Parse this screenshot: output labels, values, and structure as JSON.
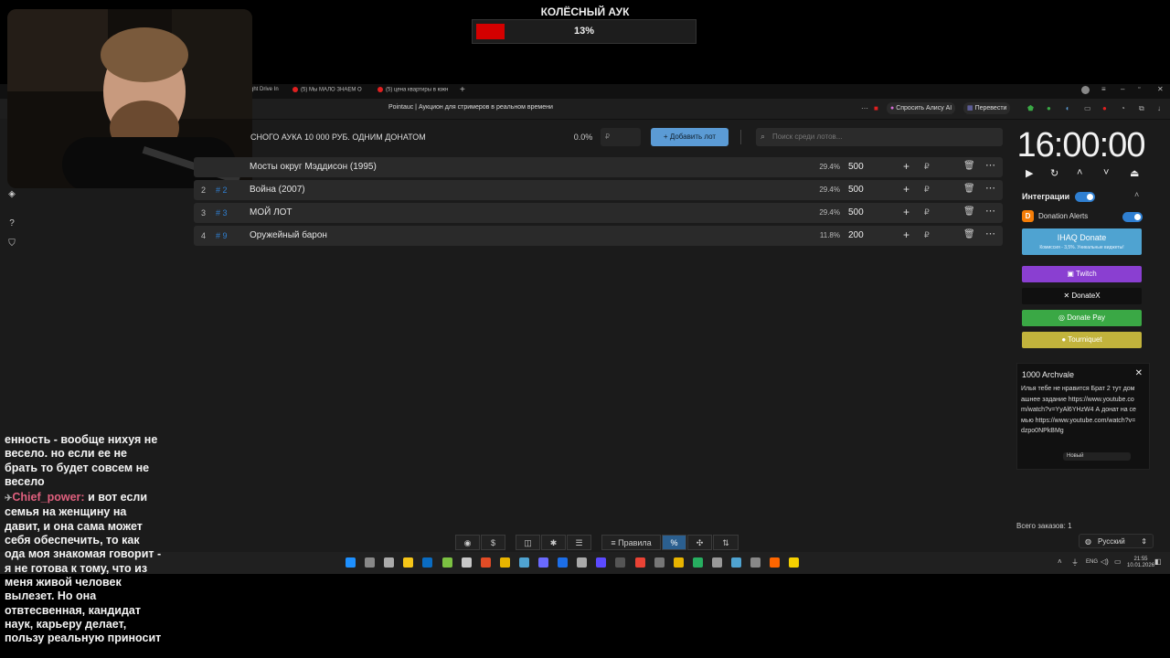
{
  "overlay": {
    "title": "КОЛЁСНЫЙ АУК",
    "progress_text": "13%",
    "progress": 0.13
  },
  "browser": {
    "tabs": [
      "ght Drive In",
      "(5) Мы МАЛО ЗНАЕМ О",
      "(5) цена квартиры в южн"
    ],
    "page_title": "Pointauc | Аукцион для стримеров в реальном времени",
    "ask_alice": "Спросить Алису AI",
    "translate": "Перевести"
  },
  "auction": {
    "title": "СНОГО АУКА 10 000 РУБ. ОДНИМ ДОНАТОМ",
    "pct": "0.0%",
    "rub_placeholder": "₽",
    "add_lot": "Добавить лот",
    "search_placeholder": "Поиск среди лотов...",
    "lots": [
      {
        "num": "",
        "id": "",
        "name": "Мосты округ Мэддисон (1995)",
        "pct": "29.4%",
        "amount": "500"
      },
      {
        "num": "2",
        "id": "# 2",
        "name": "Война (2007)",
        "pct": "29.4%",
        "amount": "500"
      },
      {
        "num": "3",
        "id": "# 3",
        "name": "МОЙ ЛОТ",
        "pct": "29.4%",
        "amount": "500"
      },
      {
        "num": "4",
        "id": "# 9",
        "name": "Оружейный барон",
        "pct": "11.8%",
        "amount": "200"
      }
    ]
  },
  "panel": {
    "timer": "16:00:00",
    "integrations": "Интеграции",
    "donation_alerts": "Donation Alerts",
    "ihaq_title": "IHAQ Donate",
    "ihaq_sub": "Комиссия - 3,5%. Уникальные виджеты!",
    "buttons": [
      {
        "label": "Twitch",
        "icon": "twitch-icon",
        "bg": "#8a3fd1",
        "fg": "#ffffff"
      },
      {
        "label": "DonateX",
        "icon": "x-icon",
        "bg": "#101010",
        "fg": "#ffffff"
      },
      {
        "label": "Donate Pay",
        "icon": "donatepay-icon",
        "bg": "#3aa845",
        "fg": "#ffffff"
      },
      {
        "label": "Tourniquet",
        "icon": "tourniquet-icon",
        "bg": "#c2b33c",
        "fg": "#ffffff"
      }
    ],
    "popup_title": "1000 Archvale",
    "popup_message": "Илья тебе не нравится Брат 2 тут домашнее задание https://www.youtube.com/watch?v=YyAl6YHzW4 А донат на семью https://www.youtube.com/watch?v=dzpo0NPkBMg",
    "popup_badge": "Новый",
    "orders_label": "Всего заказов:",
    "orders_count": "1",
    "language": "Русский"
  },
  "bottom_toolbar": {
    "rules": "Правила",
    "percent": "%"
  },
  "taskbar": {
    "lang": "ENG",
    "time": "21:55",
    "date": "10.01.2026"
  },
  "stream_chat": {
    "line1": "енность - вообще нихуя не весело. но если ее не брать то будет совсем не весело",
    "user": "Chief_power:",
    "message": "и вот если семья на женщину на давит, и она сама может себя обеспечить, то как ода моя знакомая говорит - я не готова к тому, что из меня живой человек вылезет. Но она отвтесвенная, кандидат наук, карьеру делает, пользу реальную приносит"
  },
  "colors": {
    "accent": "#5b9bd5",
    "progress": "#d40000",
    "chat_user": "#e0607e"
  }
}
